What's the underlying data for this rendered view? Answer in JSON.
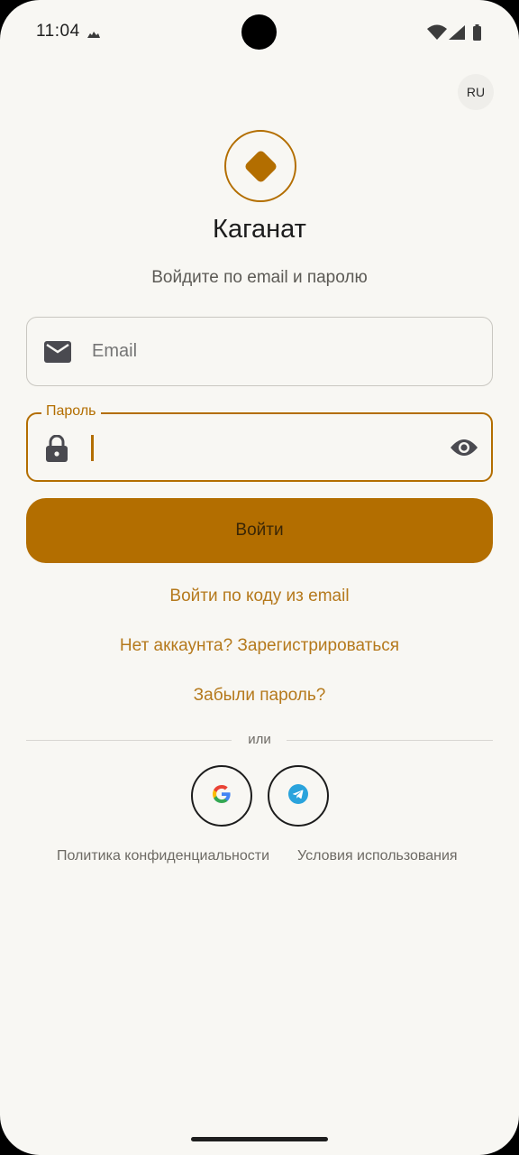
{
  "status_bar": {
    "time": "11:04",
    "notification_icon": "cloud-icon",
    "icons": [
      "wifi-icon",
      "signal-icon",
      "battery-icon"
    ]
  },
  "lang_button": "RU",
  "app": {
    "title": "Каганат",
    "subtitle": "Войдите по email и паролю"
  },
  "email_field": {
    "icon": "mail-icon",
    "placeholder": "Email",
    "value": ""
  },
  "password_field": {
    "label": "Пароль",
    "icon": "lock-icon",
    "toggle_icon": "eye-icon",
    "value": ""
  },
  "login_button": "Войти",
  "links": {
    "code_login": "Войти по коду из email",
    "register": "Нет аккаунта? Зарегистрироваться",
    "forgot": "Забыли пароль?"
  },
  "divider": "или",
  "social": [
    "google-icon",
    "telegram-icon"
  ],
  "footer": {
    "privacy": "Политика конфиденциальности",
    "terms": "Условия использования"
  },
  "colors": {
    "accent": "#b36e00",
    "background": "#f8f7f3",
    "link": "#b5791c"
  }
}
